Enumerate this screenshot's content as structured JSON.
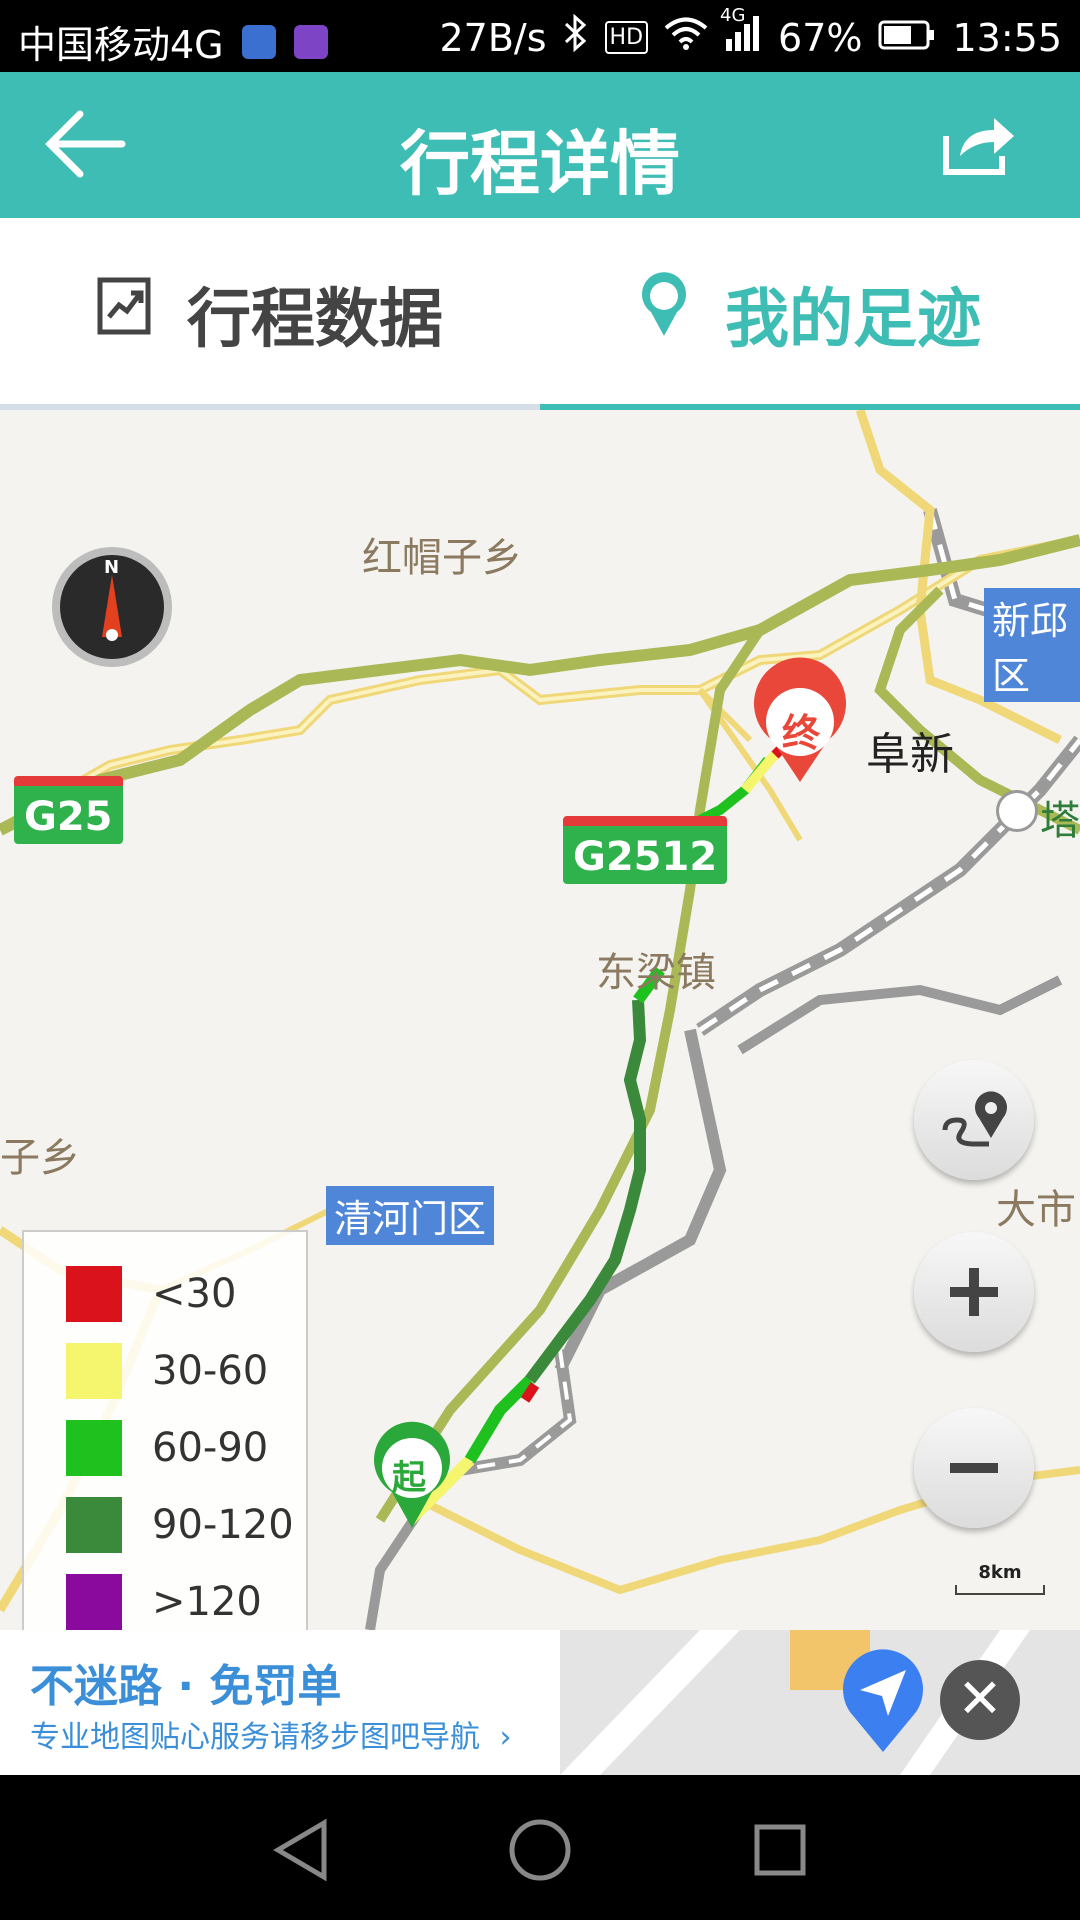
{
  "status_bar": {
    "carrier": "中国移动4G",
    "net_speed": "27B/s",
    "hd_badge": "HD",
    "network_type": "4G",
    "battery_percent": "67%",
    "battery_level": 0.67,
    "time": "13:55"
  },
  "header": {
    "title": "行程详情",
    "back_icon": "back-arrow-icon",
    "share_icon": "share-icon"
  },
  "tabs": [
    {
      "label": "行程数据",
      "icon": "chart-icon",
      "active": false
    },
    {
      "label": "我的足迹",
      "icon": "location-pin-icon",
      "active": true
    }
  ],
  "map": {
    "labels": {
      "hongmaozi": "红帽子乡",
      "dongliang": "东梁镇",
      "fuxin": "阜新",
      "xinqiu": "新邱区",
      "qing_district": "清河门区",
      "ta": "塔",
      "zi_xiang": "子乡",
      "da_shi": "大市"
    },
    "road_shields": {
      "g25": "G25",
      "g2512": "G2512"
    },
    "markers": {
      "start": "起",
      "end": "终"
    },
    "compass_label": "N",
    "scale": "8km",
    "legend": [
      {
        "label": "<30",
        "color": "#d9121c"
      },
      {
        "label": "30-60",
        "color": "#f5f56e"
      },
      {
        "label": "60-90",
        "color": "#1fc11f"
      },
      {
        "label": "90-120",
        "color": "#3b8a3b"
      },
      {
        "label": ">120",
        "color": "#8a0a9e"
      }
    ],
    "controls": [
      "route-icon",
      "zoom-in-icon",
      "zoom-out-icon"
    ]
  },
  "ad": {
    "title": "不迷路 · 免罚单",
    "subtitle": "专业地图贴心服务请移步图吧导航",
    "chevron": "›",
    "close_symbol": "✕"
  },
  "colors": {
    "accent": "#3dbdb4",
    "ad_blue": "#3a8fd8"
  }
}
